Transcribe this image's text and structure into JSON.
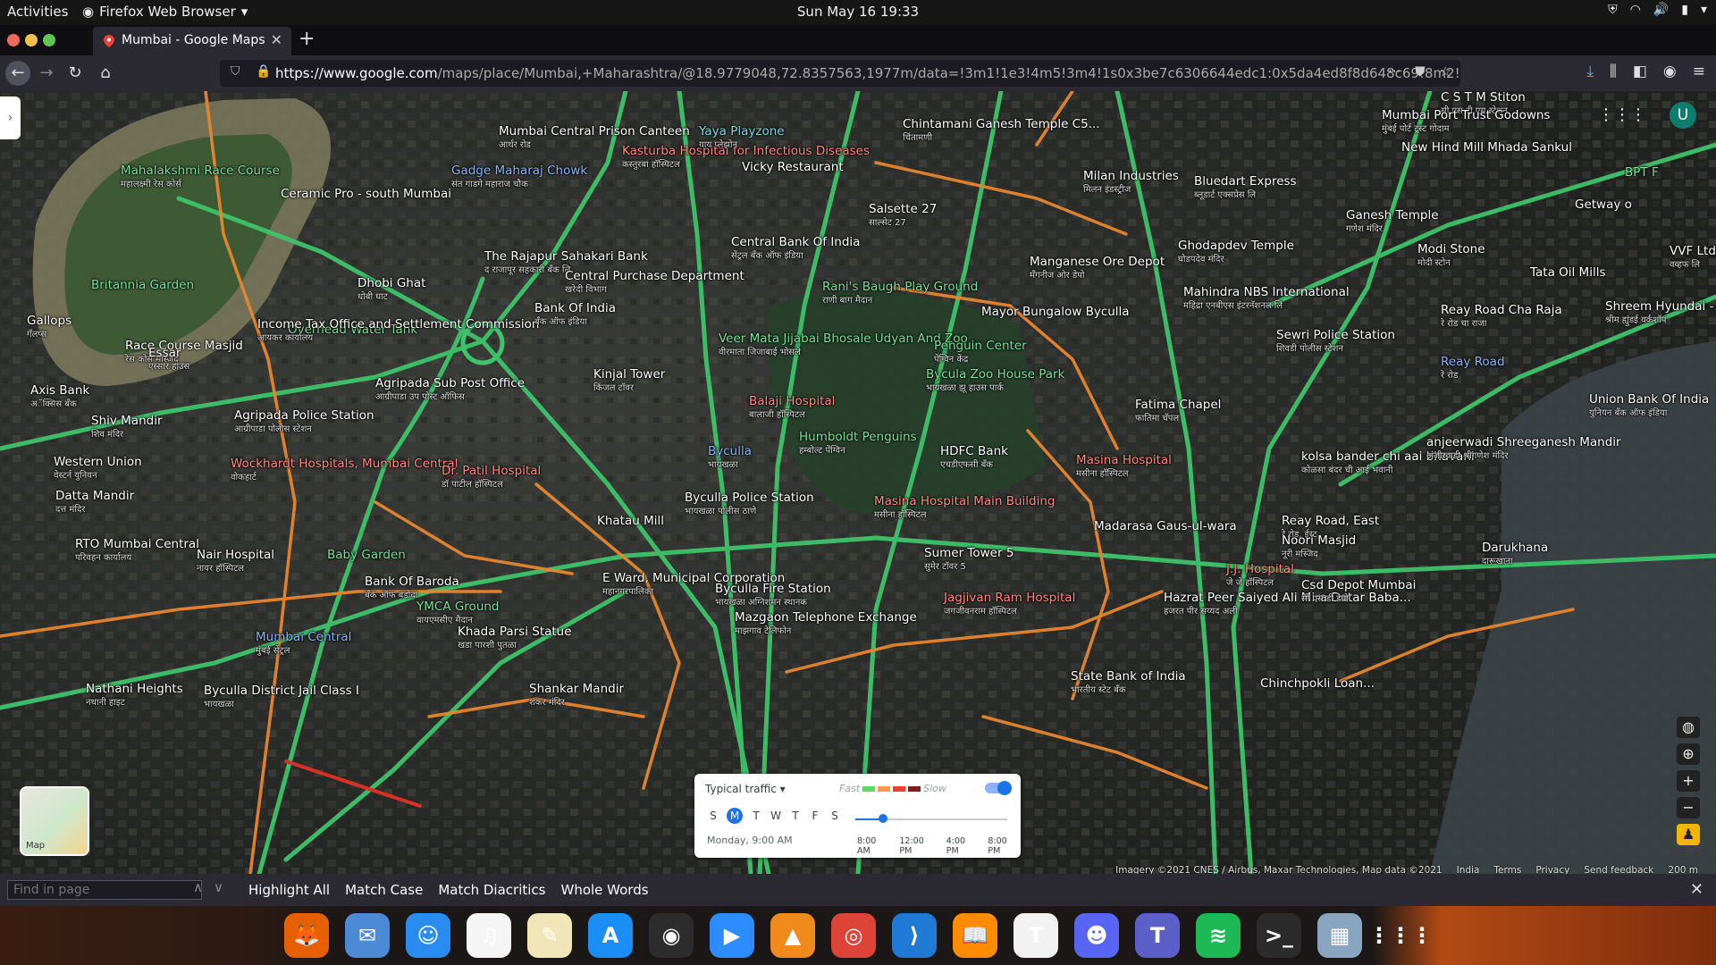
{
  "topbar": {
    "activities": "Activities",
    "app_name": "Firefox Web Browser",
    "clock": "Sun May 16  19:33"
  },
  "tab": {
    "title": "Mumbai - Google Maps",
    "new_tab": "+"
  },
  "urlbar": {
    "host": "https://www.google.com",
    "path": "/maps/place/Mumbai,+Maharashtra/@18.9779048,72.8357563,1977m/data=!3m1!1e3!4m5!3m4!1s0x3be7c6306644edc1:0x5da4ed8f8d648c69!8m2!3d"
  },
  "map": {
    "labels": [
      {
        "text": "Mahalakshmi Race Course",
        "sub": "महालक्ष्मी रेस कोर्स",
        "cls": "poi-green"
      },
      {
        "text": "Britannia Garden",
        "sub": "",
        "cls": "poi-green"
      },
      {
        "text": "Gallops",
        "sub": "गॅलप्स",
        "cls": ""
      },
      {
        "text": "Race Course Masjid",
        "sub": "रेस कोर्स मस्जिद",
        "cls": ""
      },
      {
        "text": "Ceramic Pro - south Mumbai",
        "sub": "",
        "cls": ""
      },
      {
        "text": "Dhobi Ghat",
        "sub": "धोबी घाट",
        "cls": ""
      },
      {
        "text": "Mumbai Central Prison Canteen",
        "sub": "आर्थर रोड",
        "cls": ""
      },
      {
        "text": "Gadge Maharaj Chowk",
        "sub": "संत गाडगे महाराज चौक",
        "cls": "poi-blue"
      },
      {
        "text": "Kasturba Hospital for Infectious Diseases",
        "sub": "कस्तुरबा हॉस्पिटल",
        "cls": "poi-red"
      },
      {
        "text": "Yaya Playzone",
        "sub": "याय प्लेझोन",
        "cls": "poi-teal"
      },
      {
        "text": "Vicky Restaurant",
        "sub": "",
        "cls": ""
      },
      {
        "text": "The Rajapur Sahakari Bank",
        "sub": "द राजापूर सहकारी बँक लि",
        "cls": ""
      },
      {
        "text": "Overhead Water Tank",
        "sub": "",
        "cls": "poi-green"
      },
      {
        "text": "Central Purchase Department",
        "sub": "खरेदी विभाग",
        "cls": ""
      },
      {
        "text": "Central Bank Of India",
        "sub": "सेंट्रल बँक ऑफ इंडिया",
        "cls": ""
      },
      {
        "text": "Salsette 27",
        "sub": "साल्सेट 27",
        "cls": ""
      },
      {
        "text": "Chintamani Ganesh Temple C5...",
        "sub": "चिंतामणी",
        "cls": ""
      },
      {
        "text": "Essar",
        "sub": "एस्सार हाउस",
        "cls": ""
      },
      {
        "text": "Income Tax Office and Settlement Commission",
        "sub": "आयकर कार्यालय",
        "cls": ""
      },
      {
        "text": "Bank Of India",
        "sub": "बँक ऑफ इंडिया",
        "cls": ""
      },
      {
        "text": "Rani's Baugh Play Ground",
        "sub": "राणी बाग मैदान",
        "cls": "poi-green"
      },
      {
        "text": "Mayor Bungalow Byculla",
        "sub": "",
        "cls": ""
      },
      {
        "text": "Veer Mata Jijabai Bhosale Udyan And Zoo",
        "sub": "वीरमाता जिजाबाई भोसले",
        "cls": "poi-green"
      },
      {
        "text": "Penguin Center",
        "sub": "पेंग्विन केंद्र",
        "cls": "poi-green"
      },
      {
        "text": "Bycula Zoo House Park",
        "sub": "भायखळा झू हाउस पार्क",
        "cls": "poi-green"
      },
      {
        "text": "Axis Bank",
        "sub": "अॅक्सिस बँक",
        "cls": ""
      },
      {
        "text": "Agripada Sub Post Office",
        "sub": "आग्रीपाडा उप पोस्ट ऑफिस",
        "cls": ""
      },
      {
        "text": "Kinjal Tower",
        "sub": "किंजल टॉवर",
        "cls": ""
      },
      {
        "text": "Balaji Hospital",
        "sub": "बालाजी हॉस्पिटल",
        "cls": "poi-red"
      },
      {
        "text": "Shiv Mandir",
        "sub": "शिव मंदिर",
        "cls": ""
      },
      {
        "text": "Agripada Police Station",
        "sub": "आग्रीपाडा पोलीस स्टेशन",
        "cls": ""
      },
      {
        "text": "Humboldt Penguins",
        "sub": "हम्बोल्ट पेंग्विन",
        "cls": "poi-green"
      },
      {
        "text": "HDFC Bank",
        "sub": "एचडीएफसी बँक",
        "cls": ""
      },
      {
        "text": "Masina Hospital",
        "sub": "मसीना हॉस्पिटल",
        "cls": "poi-red"
      },
      {
        "text": "Western Union",
        "sub": "वेस्टर्न युनियन",
        "cls": ""
      },
      {
        "text": "Wockhardt Hospitals, Mumbai Central",
        "sub": "वोकहार्ट",
        "cls": "poi-red"
      },
      {
        "text": "Dr. Patil Hospital",
        "sub": "डॉ पाटील हॉस्पिटल",
        "cls": "poi-red"
      },
      {
        "text": "Byculla",
        "sub": "भायखळा",
        "cls": "poi-blue"
      },
      {
        "text": "Datta Mandir",
        "sub": "दत्त मंदिर",
        "cls": ""
      },
      {
        "text": "Byculla Police Station",
        "sub": "भायखळा पोलीस ठाणे",
        "cls": ""
      },
      {
        "text": "Masina Hospital Main Building",
        "sub": "मसीना हॉस्पिटल",
        "cls": "poi-red"
      },
      {
        "text": "Khatau Mill",
        "sub": "",
        "cls": ""
      },
      {
        "text": "RTO Mumbai Central",
        "sub": "परिवहन कार्यालय",
        "cls": ""
      },
      {
        "text": "Nair Hospital",
        "sub": "नायर हॉस्पिटल",
        "cls": ""
      },
      {
        "text": "Baby Garden",
        "sub": "",
        "cls": "poi-green"
      },
      {
        "text": "Sumer Tower 5",
        "sub": "सुमेर टॉवर 5",
        "cls": ""
      },
      {
        "text": "Byculla Fire Station",
        "sub": "भायखळा अग्निशमन स्थानक",
        "cls": ""
      },
      {
        "text": "E Ward, Municipal Corporation",
        "sub": "महानगरपालिका",
        "cls": ""
      },
      {
        "text": "YMCA Ground",
        "sub": "वायएमसीए मैदान",
        "cls": "poi-green"
      },
      {
        "text": "Bank Of Baroda",
        "sub": "बँक ऑफ बडोदा",
        "cls": ""
      },
      {
        "text": "Khada Parsi Statue",
        "sub": "खडा पारशी पुतळा",
        "cls": ""
      },
      {
        "text": "Mazgaon Telephone Exchange",
        "sub": "माझगाव टेलिफोन",
        "cls": ""
      },
      {
        "text": "Jagjivan Ram Hospital",
        "sub": "जगजीवनराम हॉस्पिटल",
        "cls": "poi-red"
      },
      {
        "text": "Mumbai Central",
        "sub": "मुंबई सेंट्रल",
        "cls": "poi-blue"
      },
      {
        "text": "Nathani Heights",
        "sub": "नथानी हाइट",
        "cls": ""
      },
      {
        "text": "Byculla District Jail Class I",
        "sub": "भायखळा",
        "cls": ""
      },
      {
        "text": "Shankar Mandir",
        "sub": "शंकर मंदिर",
        "cls": ""
      },
      {
        "text": "C S T M Stiton",
        "sub": "सी एस टी एम स्टेशन",
        "cls": ""
      },
      {
        "text": "Mumbai Port Trust Godowns",
        "sub": "मुंबई पोर्ट ट्रस्ट गोदाम",
        "cls": ""
      },
      {
        "text": "New Hind Mill Mhada Sankul",
        "sub": "",
        "cls": ""
      },
      {
        "text": "Milan Industries",
        "sub": "मिलन इंडस्ट्रीज",
        "cls": ""
      },
      {
        "text": "Bluedart Express",
        "sub": "ब्लूडार्ट एक्सप्रेस लि",
        "cls": ""
      },
      {
        "text": "Ganesh Temple",
        "sub": "गणेश मंदिर",
        "cls": ""
      },
      {
        "text": "Ghodapdev Temple",
        "sub": "घोडपदेव मंदिर",
        "cls": ""
      },
      {
        "text": "Manganese Ore Depot",
        "sub": "मॅंगनीज ओर डेपो",
        "cls": ""
      },
      {
        "text": "Mahindra NBS International",
        "sub": "महिंद्रा एनबीएस इंटरनॅशनल लि",
        "cls": ""
      },
      {
        "text": "Modi Stone",
        "sub": "मोदी स्टोन",
        "cls": ""
      },
      {
        "text": "Getway o",
        "sub": "",
        "cls": ""
      },
      {
        "text": "BPT F",
        "sub": "",
        "cls": "poi-green"
      },
      {
        "text": "VVF Ltd",
        "sub": "वव्हफ लि",
        "cls": ""
      },
      {
        "text": "Tata Oil Mills",
        "sub": "",
        "cls": ""
      },
      {
        "text": "Shreem Hyundai - Workshop, Reay Road",
        "sub": "श्रीम ह्युंडई वर्कशॉप",
        "cls": ""
      },
      {
        "text": "Reay Road Cha Raja",
        "sub": "रे रोड चा राजा",
        "cls": ""
      },
      {
        "text": "Sewri Police Station",
        "sub": "शिवडी पोलीस स्टेशन",
        "cls": ""
      },
      {
        "text": "Reay Road",
        "sub": "रे रोड",
        "cls": "poi-blue"
      },
      {
        "text": "Fatima Chapel",
        "sub": "फातिमा चॅपल",
        "cls": ""
      },
      {
        "text": "Union Bank Of India",
        "sub": "युनियन बँक ऑफ इंडिया",
        "cls": ""
      },
      {
        "text": "kolsa bander chi aai bhavani",
        "sub": "कोळसा बंदर ची आई भवानी",
        "cls": ""
      },
      {
        "text": "anjeerwadi Shreeganesh Mandir",
        "sub": "अंजीरवाडी श्रीगणेश मंदिर",
        "cls": ""
      },
      {
        "text": "Madarasa Gaus-ul-wara",
        "sub": "",
        "cls": ""
      },
      {
        "text": "Reay Road, East",
        "sub": "रे रोड, ईस्ट",
        "cls": ""
      },
      {
        "text": "Noori Masjid",
        "sub": "नूरी मस्जिद",
        "cls": ""
      },
      {
        "text": "Darukhana",
        "sub": "दारूखाना",
        "cls": ""
      },
      {
        "text": "J.J. Hospital",
        "sub": "जे जे हॉस्पिटल",
        "cls": "poi-red"
      },
      {
        "text": "Hazrat Peer Saiyed Ali Mira Datar Baba...",
        "sub": "हजरत पीर सय्यद अली",
        "cls": ""
      },
      {
        "text": "Csd Depot Mumbai",
        "sub": "सी एस डी डेपो",
        "cls": ""
      },
      {
        "text": "State Bank of India",
        "sub": "भारतीय स्टेट बँक",
        "cls": ""
      },
      {
        "text": "Chinchpokli Loan...",
        "sub": "",
        "cls": ""
      }
    ],
    "side_toggle": "›",
    "user_initial": "U",
    "minimap_label": "Map",
    "controls": {
      "layers": "◍",
      "locate": "⊕",
      "zoom_in": "+",
      "zoom_out": "−",
      "pegman": "♟"
    },
    "traffic": {
      "title": "Typical traffic",
      "fast": "Fast",
      "slow": "Slow",
      "days": [
        "S",
        "M",
        "T",
        "W",
        "T",
        "F",
        "S"
      ],
      "selected_day": "M",
      "when": "Monday, 9:00 AM",
      "ticks": [
        "8:00 AM",
        "12:00 PM",
        "4:00 PM",
        "8:00 PM"
      ],
      "slider_value": 0.18
    },
    "attribution": {
      "imagery": "Imagery ©2021 CNES / Airbus, Maxar Technologies, Map data ©2021",
      "country": "India",
      "terms": "Terms",
      "privacy": "Privacy",
      "feedback": "Send feedback",
      "scale": "200 m"
    },
    "colors": {
      "road_green": "#3ec36a",
      "road_orange": "#e8862f",
      "road_red": "#d93025"
    }
  },
  "findbar": {
    "placeholder": "Find in page",
    "highlight_all": "Highlight All",
    "match_case": "Match Case",
    "match_diacritics": "Match Diacritics",
    "whole_words": "Whole Words"
  },
  "dock": {
    "apps": [
      {
        "name": "firefox",
        "glyph": "🦊",
        "color": "#e66000"
      },
      {
        "name": "mail",
        "glyph": "✉",
        "color": "#4d8ad6"
      },
      {
        "name": "finder",
        "glyph": "☺",
        "color": "#2a8cf0"
      },
      {
        "name": "music",
        "glyph": "♫",
        "color": "#f5f5f5"
      },
      {
        "name": "notes",
        "glyph": "✎",
        "color": "#f2e6b8"
      },
      {
        "name": "app-store",
        "glyph": "A",
        "color": "#1a8ef5"
      },
      {
        "name": "obs",
        "glyph": "◉",
        "color": "#2c2c2c"
      },
      {
        "name": "zoom",
        "glyph": "▶",
        "color": "#2d8cff"
      },
      {
        "name": "vlc",
        "glyph": "▲",
        "color": "#f08a1c"
      },
      {
        "name": "chrome",
        "glyph": "◎",
        "color": "#db4437"
      },
      {
        "name": "vscode",
        "glyph": "⟩",
        "color": "#1f7ad6"
      },
      {
        "name": "books",
        "glyph": "📖",
        "color": "#ff8c00"
      },
      {
        "name": "typora",
        "glyph": "T",
        "color": "#f2f2f2"
      },
      {
        "name": "discord",
        "glyph": "☻",
        "color": "#5865f2"
      },
      {
        "name": "teams",
        "glyph": "T",
        "color": "#5b5fc7"
      },
      {
        "name": "spotify",
        "glyph": "≋",
        "color": "#1db954"
      },
      {
        "name": "terminal",
        "glyph": ">_",
        "color": "#2b2b2b"
      },
      {
        "name": "preview",
        "glyph": "▦",
        "color": "#8aa5c0"
      },
      {
        "name": "app-grid",
        "glyph": "⋮⋮⋮",
        "color": "transparent"
      }
    ]
  }
}
